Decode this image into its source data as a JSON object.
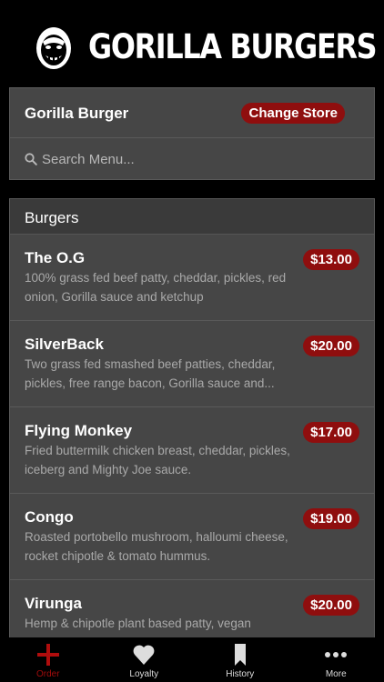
{
  "header": {
    "brand": "GORILLA BURGERS",
    "logo_icon": "gorilla-logo"
  },
  "store": {
    "name": "Gorilla Burger",
    "change_label": "Change Store",
    "search_placeholder": "Search Menu...",
    "search_icon": "search-icon"
  },
  "menu": {
    "section": "Burgers",
    "items": [
      {
        "name": "The O.G",
        "price": "$13.00",
        "description": "100% grass fed beef patty, cheddar, pickles, red onion, Gorilla sauce and ketchup"
      },
      {
        "name": "SilverBack",
        "price": "$20.00",
        "description": "Two grass fed smashed beef patties, cheddar, pickles, free range bacon, Gorilla sauce and..."
      },
      {
        "name": "Flying Monkey",
        "price": "$17.00",
        "description": "Fried buttermilk chicken breast, cheddar, pickles, iceberg and Mighty Joe sauce."
      },
      {
        "name": "Congo",
        "price": "$19.00",
        "description": "Roasted portobello mushroom, halloumi cheese, rocket chipotle & tomato hummus."
      },
      {
        "name": "Virunga",
        "price": "$20.00",
        "description": "Hemp & chipotle plant based patty, vegan"
      }
    ]
  },
  "tabs": [
    {
      "label": "Order",
      "icon": "plus-icon",
      "active": true
    },
    {
      "label": "Loyalty",
      "icon": "heart-icon",
      "active": false
    },
    {
      "label": "History",
      "icon": "bookmark-icon",
      "active": false
    },
    {
      "label": "More",
      "icon": "more-dots-icon",
      "active": false
    }
  ],
  "colors": {
    "accent": "#8f0e0e",
    "background": "#000000",
    "card": "#464646"
  }
}
